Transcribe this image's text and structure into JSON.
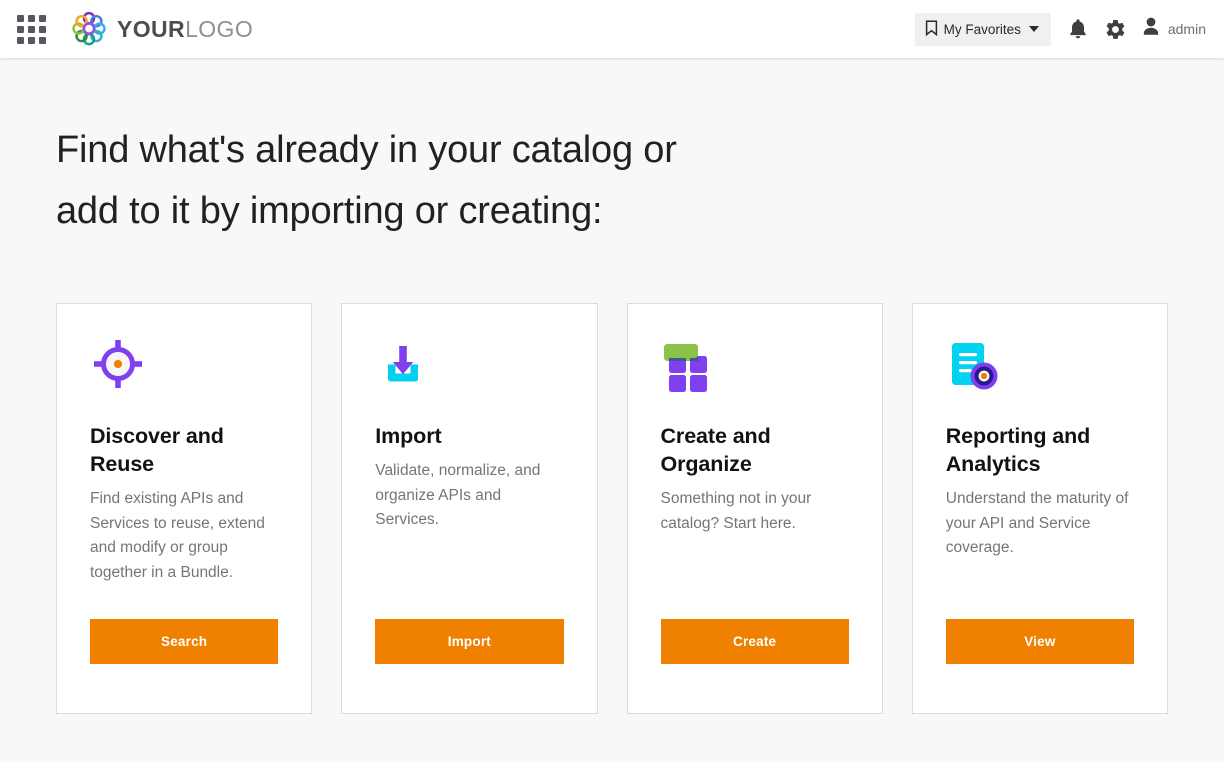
{
  "header": {
    "apps_icon": "apps-grid-icon",
    "logo": {
      "icon": "flower-ring-logo-icon",
      "bold_part": "YOUR",
      "light_part": "LOGO",
      "petal_colors": [
        "#7B2FBE",
        "#4A7FD4",
        "#3FA9F5",
        "#2FB3C9",
        "#1FA88A",
        "#4CAF3E",
        "#8CC63F",
        "#F5A623",
        "#9B51E0"
      ]
    },
    "favorites": {
      "icon": "bookmark-icon",
      "label": "My Favorites",
      "caret_icon": "chevron-down-icon"
    },
    "notifications_icon": "bell-icon",
    "settings_icon": "gear-icon",
    "user": {
      "avatar_icon": "person-icon",
      "name": "admin"
    }
  },
  "main": {
    "title_line_1": "Find what's already in your catalog or",
    "title_line_2": "add to it by importing or creating:",
    "cards": [
      {
        "icon": "target-crosshair-icon",
        "title": "Discover and Reuse",
        "description": "Find existing APIs and Services to reuse, extend and modify or group together in a Bundle.",
        "cta_label": "Search"
      },
      {
        "icon": "download-tray-icon",
        "title": "Import",
        "description": "Validate, normalize, and organize APIs and Services.",
        "cta_label": "Import"
      },
      {
        "icon": "grid-blocks-icon",
        "title": "Create and Organize",
        "description": "Something not in your catalog? Start here.",
        "cta_label": "Create"
      },
      {
        "icon": "report-document-icon",
        "title": "Reporting and Analytics",
        "description": "Understand the maturity of your API and Service coverage.",
        "cta_label": "View"
      }
    ]
  },
  "colors": {
    "accent_orange": "#f08000",
    "purple": "#7c4dff",
    "cyan": "#00d2f0",
    "green": "#8bc34a",
    "page_background": "#f8f8f8",
    "header_background": "#ffffff",
    "card_border": "#dcdcdc",
    "body_text": "#757575"
  }
}
